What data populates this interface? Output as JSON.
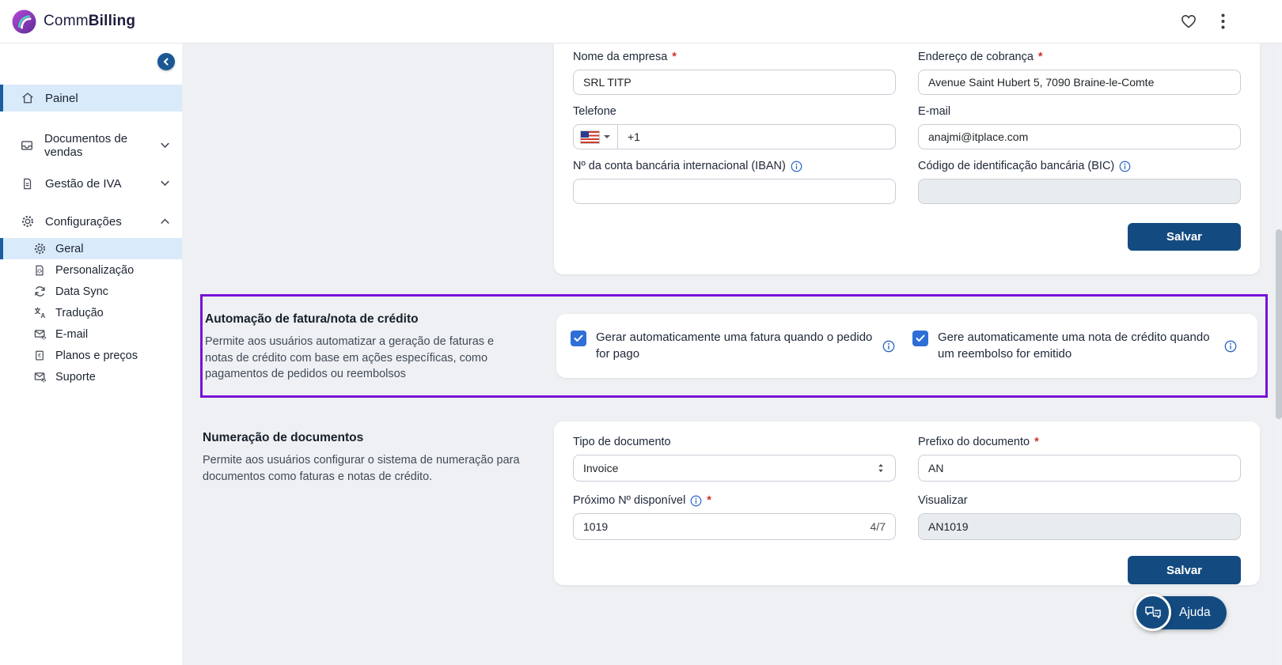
{
  "header": {
    "brand_part1": "Comm",
    "brand_part2": "Billing"
  },
  "sidebar": {
    "items": [
      {
        "label": "Painel",
        "icon": "home-icon",
        "active": true
      },
      {
        "label": "Documentos de vendas",
        "icon": "inbox-icon",
        "chevron": "down"
      },
      {
        "label": "Gestão de IVA",
        "icon": "document-icon",
        "chevron": "down"
      },
      {
        "label": "Configurações",
        "icon": "gear-icon",
        "chevron": "up",
        "expanded": true
      }
    ],
    "submenu": [
      {
        "label": "Geral",
        "icon": "gear-icon",
        "active": true
      },
      {
        "label": "Personalização",
        "icon": "file-gear-icon"
      },
      {
        "label": "Data Sync",
        "icon": "sync-icon"
      },
      {
        "label": "Tradução",
        "icon": "translate-icon"
      },
      {
        "label": "E-mail",
        "icon": "mail-gear-icon"
      },
      {
        "label": "Planos e preços",
        "icon": "receipt-euro-icon"
      },
      {
        "label": "Suporte",
        "icon": "mail-gear-icon"
      }
    ]
  },
  "company_form": {
    "company_name": {
      "label": "Nome da empresa",
      "value": "SRL TITP"
    },
    "billing_address": {
      "label": "Endereço de cobrança",
      "value": "Avenue Saint Hubert 5, 7090 Braine-le-Comte"
    },
    "phone": {
      "label": "Telefone",
      "value": "+1",
      "flag": "us-flag-icon"
    },
    "email": {
      "label": "E-mail",
      "value": "anajmi@itplace.com"
    },
    "iban": {
      "label": "Nº da conta bancária internacional (IBAN)",
      "value": ""
    },
    "bic": {
      "label": "Código de identificação bancária (BIC)",
      "value": "",
      "disabled": true
    },
    "save_label": "Salvar"
  },
  "automation_section": {
    "title": "Automação de fatura/nota de crédito",
    "description": "Permite aos usuários automatizar a geração de faturas e notas de crédito com base em ações específicas, como pagamentos de pedidos ou reembolsos",
    "checkboxes": [
      {
        "label": "Gerar automaticamente uma fatura quando o pedido for pago",
        "checked": true
      },
      {
        "label": "Gere automaticamente uma nota de crédito quando um reembolso for emitido",
        "checked": true
      }
    ]
  },
  "numbering_section": {
    "title": "Numeração de documentos",
    "description": "Permite aos usuários configurar o sistema de numeração para documentos como faturas e notas de crédito.",
    "doc_type": {
      "label": "Tipo de documento",
      "value": "Invoice"
    },
    "prefix": {
      "label": "Prefixo do documento",
      "value": "AN"
    },
    "next_number": {
      "label": "Próximo Nº disponível",
      "value": "1019",
      "counter": "4/7"
    },
    "preview": {
      "label": "Visualizar",
      "value": "AN1019",
      "disabled": true
    },
    "save_label": "Salvar"
  },
  "help_button": {
    "label": "Ajuda"
  },
  "ui": {
    "required_mark": "*"
  },
  "colors": {
    "primary_button": "#134b80",
    "accent_purple": "#7712d6",
    "checkbox_blue": "#2e6fd6",
    "sidebar_active_bg": "#d9eafb",
    "info_icon_blue": "#2b66c4",
    "content_background": "#eef0f3"
  }
}
